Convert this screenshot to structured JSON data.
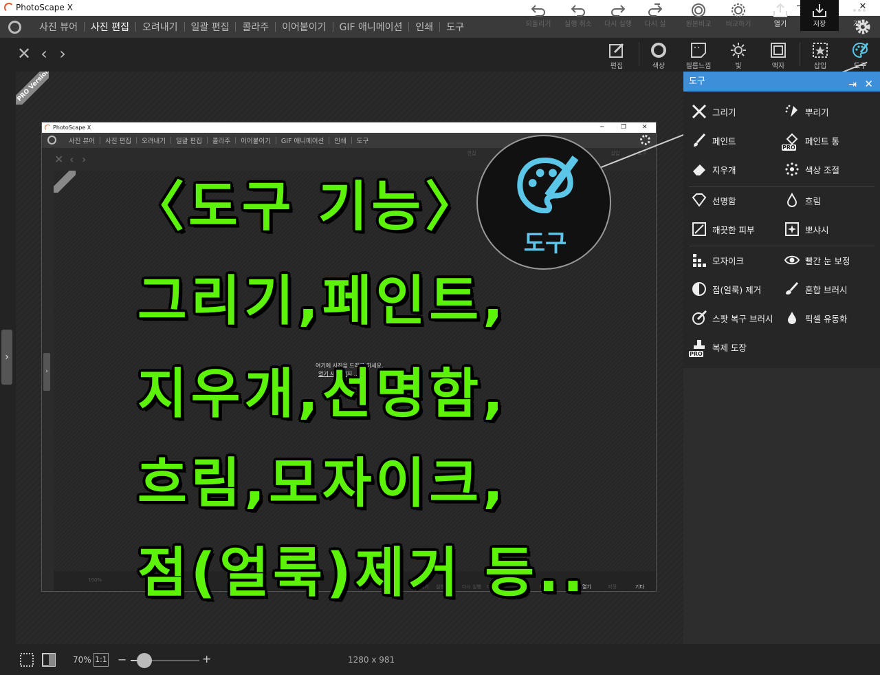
{
  "window": {
    "title": "PhotoScape X",
    "minimize": "─",
    "maximize": "❐",
    "close": "✕"
  },
  "menu": {
    "items": [
      "사진 뷰어",
      "사진 편집",
      "오려내기",
      "일괄 편집",
      "콜라주",
      "이어붙이기",
      "GIF 애니메이션",
      "인쇄",
      "도구"
    ],
    "active_index": 1
  },
  "nav": {
    "close": "✕",
    "prev": "‹",
    "next": "›"
  },
  "tool_tabs": [
    {
      "label": "편집",
      "icon": "edit-icon"
    },
    {
      "label": "색상",
      "icon": "circle-icon"
    },
    {
      "label": "필름느낌",
      "icon": "film-icon"
    },
    {
      "label": "빛",
      "icon": "sun-icon"
    },
    {
      "label": "액자",
      "icon": "frame-icon"
    },
    {
      "label": "삽입",
      "icon": "insert-star-icon"
    },
    {
      "label": "도구",
      "icon": "palette-icon"
    }
  ],
  "pro_badge": "PRO Version",
  "panel": {
    "title": "도구",
    "pin": "⇥",
    "close": "✕",
    "tools": [
      {
        "label": "그리기",
        "icon": "draw-icon"
      },
      {
        "label": "뿌리기",
        "icon": "spray-icon"
      },
      {
        "label": "페인트",
        "icon": "brush-icon"
      },
      {
        "label": "페인트 통",
        "icon": "paint-bucket-icon",
        "pro": "PRO"
      },
      {
        "label": "지우개",
        "icon": "eraser-icon"
      },
      {
        "label": "색상 조절",
        "icon": "color-adjust-icon"
      },
      {
        "label": "선명함",
        "icon": "diamond-icon"
      },
      {
        "label": "흐림",
        "icon": "drop-outline-icon"
      },
      {
        "label": "깨끗한 피부",
        "icon": "clean-skin-icon"
      },
      {
        "label": "뽀샤시",
        "icon": "sparkle-icon"
      },
      {
        "label": "모자이크",
        "icon": "mosaic-icon"
      },
      {
        "label": "빨간 눈 보정",
        "icon": "eye-icon"
      },
      {
        "label": "점(얼룩) 제거",
        "icon": "spot-remove-icon"
      },
      {
        "label": "혼합 브러시",
        "icon": "mix-brush-icon"
      },
      {
        "label": "스팟 복구 브러시",
        "icon": "spot-heal-icon"
      },
      {
        "label": "픽셀 유동화",
        "icon": "liquify-drop-icon"
      },
      {
        "label": "복제 도장",
        "icon": "stamp-icon",
        "pro": "PRO"
      }
    ]
  },
  "inner_screenshot": {
    "title": "PhotoScape X",
    "menu": [
      "사진 뷰어",
      "사진 편집",
      "오려내기",
      "일괄 편집",
      "콜라주",
      "이어붙이기",
      "GIF 애니메이션",
      "인쇄",
      "도구"
    ],
    "hint_line1": "여기에 사진을 드래그 하세요.",
    "hint_line2": "열기  새 이미지 ...",
    "tool_labels": [
      "편집",
      "삽입",
      "도구"
    ],
    "bottom_labels": [
      "되돌리기",
      "실행 취소",
      "다시 실행",
      "다시 실",
      "비교",
      "열기",
      "저장",
      "기타"
    ],
    "zoom": "100%"
  },
  "zoom_callout": {
    "label": "도구",
    "icon": "palette-icon"
  },
  "overlay": {
    "lines": [
      "〈도구 기능〉",
      "그리기,페인트,",
      "지우개,선명함,",
      "흐림,모자이크,",
      "점(얼룩)제거 등.."
    ],
    "color": "#5df20a"
  },
  "bottom": {
    "zoom": "70%",
    "one_to_one": "1:1",
    "zoom_level": 0.2,
    "minus": "−",
    "plus": "+",
    "dimensions": "1280 x 981",
    "buttons": [
      {
        "label": "되돌리기",
        "icon": "revert-icon",
        "enabled": false
      },
      {
        "label": "실행 취소",
        "icon": "undo-icon",
        "enabled": false
      },
      {
        "label": "다시 실행",
        "icon": "redo-icon",
        "enabled": false
      },
      {
        "label": "다시 실",
        "icon": "redo-all-icon",
        "enabled": false
      },
      {
        "label": "원본비교",
        "icon": "compare-original-icon",
        "enabled": false
      },
      {
        "label": "비교하기",
        "icon": "compare-icon",
        "enabled": false
      },
      {
        "label": "열기",
        "icon": "open-icon",
        "enabled": true
      },
      {
        "label": "저장",
        "icon": "save-icon",
        "enabled": true
      },
      {
        "label": "기타",
        "icon": "more-icon",
        "enabled": true
      }
    ]
  }
}
